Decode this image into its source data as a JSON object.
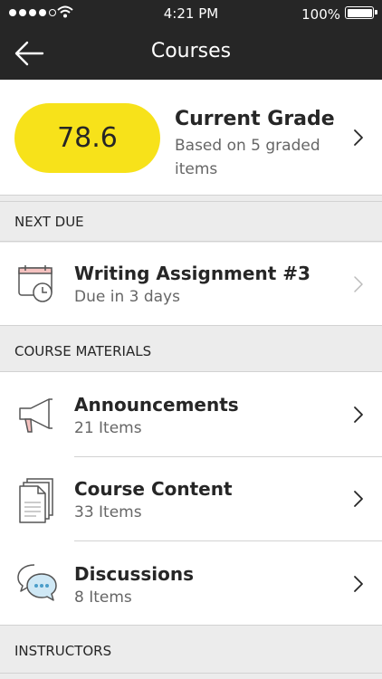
{
  "status_bar": {
    "time": "4:21 PM",
    "battery": "100%"
  },
  "nav": {
    "title": "Courses",
    "back_icon": "arrow-left-icon"
  },
  "grade": {
    "value": "78.6",
    "title": "Current Grade",
    "subtitle": "Based on 5 graded items",
    "pill_color": "#f7e21a"
  },
  "next_due": {
    "header": "NEXT DUE",
    "item": {
      "title": "Writing Assignment #3",
      "subtitle": "Due in 3 days",
      "icon": "calendar-clock-icon"
    }
  },
  "course_materials": {
    "header": "COURSE MATERIALS",
    "items": [
      {
        "title": "Announcements",
        "subtitle": "21 Items",
        "icon": "megaphone-icon"
      },
      {
        "title": "Course Content",
        "subtitle": "33 Items",
        "icon": "documents-icon"
      },
      {
        "title": "Discussions",
        "subtitle": "8 Items",
        "icon": "chat-bubbles-icon"
      }
    ]
  },
  "instructors": {
    "header": "INSTRUCTORS"
  }
}
